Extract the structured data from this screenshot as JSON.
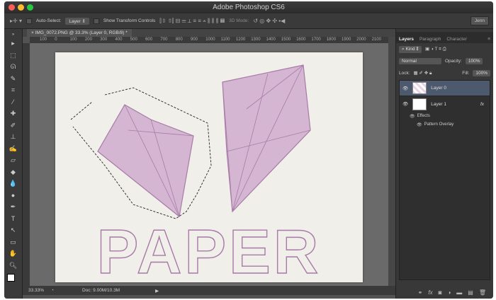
{
  "window": {
    "title": "Adobe Photoshop CS6"
  },
  "options": {
    "auto_select_label": "Auto-Select:",
    "auto_select_value": "Layer",
    "transform_label": "Show Transform Controls",
    "mode_3d_label": "3D Mode:",
    "user": "Jenn"
  },
  "document": {
    "tab_title": "IMG_0072.PNG @ 33.3% (Layer 0, RGB/8) *",
    "ruler_ticks": [
      "100",
      "0",
      "100",
      "200",
      "300",
      "400",
      "500",
      "600",
      "700",
      "800",
      "900",
      "1000",
      "1100",
      "1200",
      "1300",
      "1400",
      "1500",
      "1600",
      "1700",
      "1800",
      "1900",
      "2000",
      "2100"
    ],
    "artwork_text": "PAPER"
  },
  "status": {
    "zoom": "33.33%",
    "doc_size": "Doc: 9.00M/10.3M"
  },
  "panel": {
    "tabs": [
      "Layers",
      "Paragraph",
      "Character"
    ],
    "filter": "Kind",
    "blend_mode": "Normal",
    "opacity_label": "Opacity:",
    "opacity": "100%",
    "lock_label": "Lock:",
    "fill_label": "Fill:",
    "fill": "100%",
    "layers": [
      {
        "name": "Layer 0"
      },
      {
        "name": "Layer 1",
        "fx": "fx"
      }
    ],
    "effects_label": "Effects",
    "effect": "Pattern Overlay"
  },
  "tools": [
    "move",
    "marquee",
    "lasso",
    "quick-select",
    "crop",
    "eyedropper",
    "healing",
    "brush",
    "clone-stamp",
    "history-brush",
    "eraser",
    "gradient",
    "blur",
    "dodge",
    "pen",
    "type",
    "path-select",
    "rectangle",
    "hand",
    "zoom"
  ]
}
